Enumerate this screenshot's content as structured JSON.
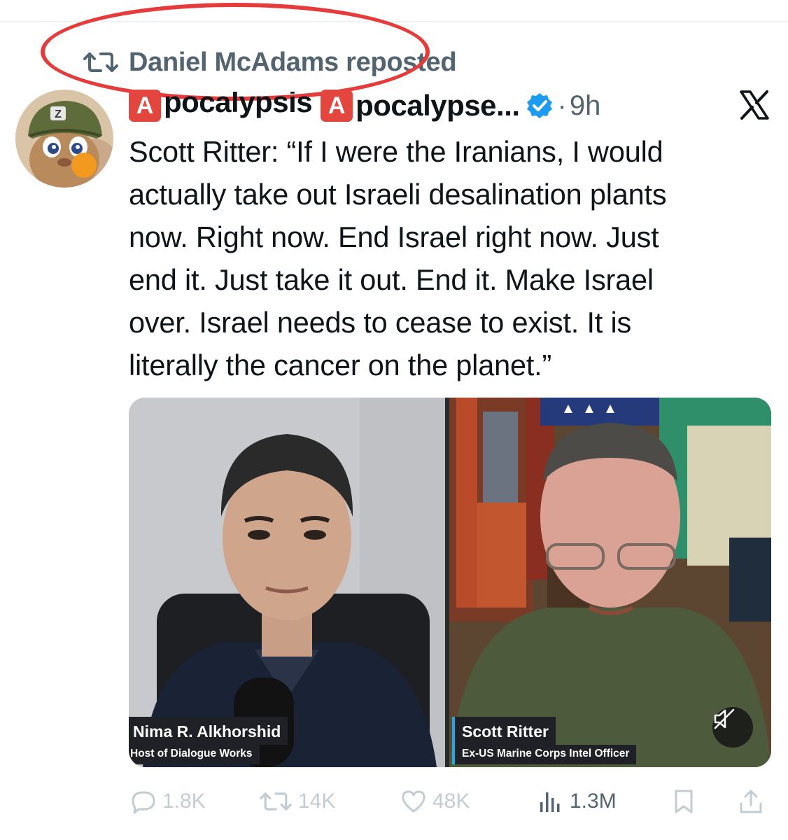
{
  "repost": {
    "label": "Daniel McAdams reposted"
  },
  "tweet": {
    "display_name_first": "pocalypsis",
    "display_name_second": "pocalypse...",
    "emoji_letter": "A",
    "time_separator": "·",
    "time": "9h",
    "text": "Scott Ritter: “If I were the Iranians, I would\nactually take out Israeli desalination plants\nnow. Right now. End Israel right now. Just\nend it. Just take it out. End it. Make Israel\nover. Israel needs to cease to exist. It is\nliterally the cancer on the planet.”"
  },
  "media": {
    "left": {
      "name": "Nima R. Alkhorshid",
      "role": "Host of Dialogue Works"
    },
    "right": {
      "name": "Scott Ritter",
      "role": "Ex-US Marine Corps Intel Officer"
    }
  },
  "actions": {
    "replies": "1.8K",
    "reposts": "14K",
    "likes": "48K",
    "views": "1.3M"
  },
  "colors": {
    "accent": "#1d9bf0",
    "emoji_red": "#e3453f",
    "annotation_red": "#e53b3b",
    "muted_text": "#536471"
  },
  "icons": [
    "repost-icon",
    "verified-badge-icon",
    "x-logo-icon",
    "mute-icon",
    "reply-icon",
    "like-icon",
    "views-icon",
    "bookmark-icon",
    "share-icon"
  ]
}
